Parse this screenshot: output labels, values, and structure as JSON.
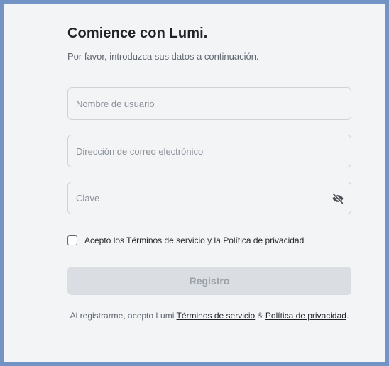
{
  "header": {
    "title": "Comience con Lumi.",
    "subtitle": "Por favor, introduzca sus datos a continuación."
  },
  "form": {
    "username": {
      "placeholder": "Nombre de usuario",
      "value": ""
    },
    "email": {
      "placeholder": "Dirección de correo electrónico",
      "value": ""
    },
    "password": {
      "placeholder": "Clave",
      "value": "",
      "toggle_icon": "eye-slash-icon"
    },
    "terms_checkbox": {
      "label": "Acepto los Términos de servicio y la Política de privacidad",
      "checked": false
    },
    "submit_label": "Registro",
    "submit_enabled": false
  },
  "legal": {
    "prefix": "Al registrarme, acepto Lumi ",
    "terms_link": "Términos de servicio",
    "separator": " & ",
    "privacy_link": "Política de privacidad",
    "suffix": "."
  },
  "colors": {
    "frame_border": "#7393c4",
    "background": "#f3f4f6",
    "text_primary": "#1f2328",
    "text_secondary": "#5f6670",
    "button_disabled_bg": "#dadde1"
  }
}
